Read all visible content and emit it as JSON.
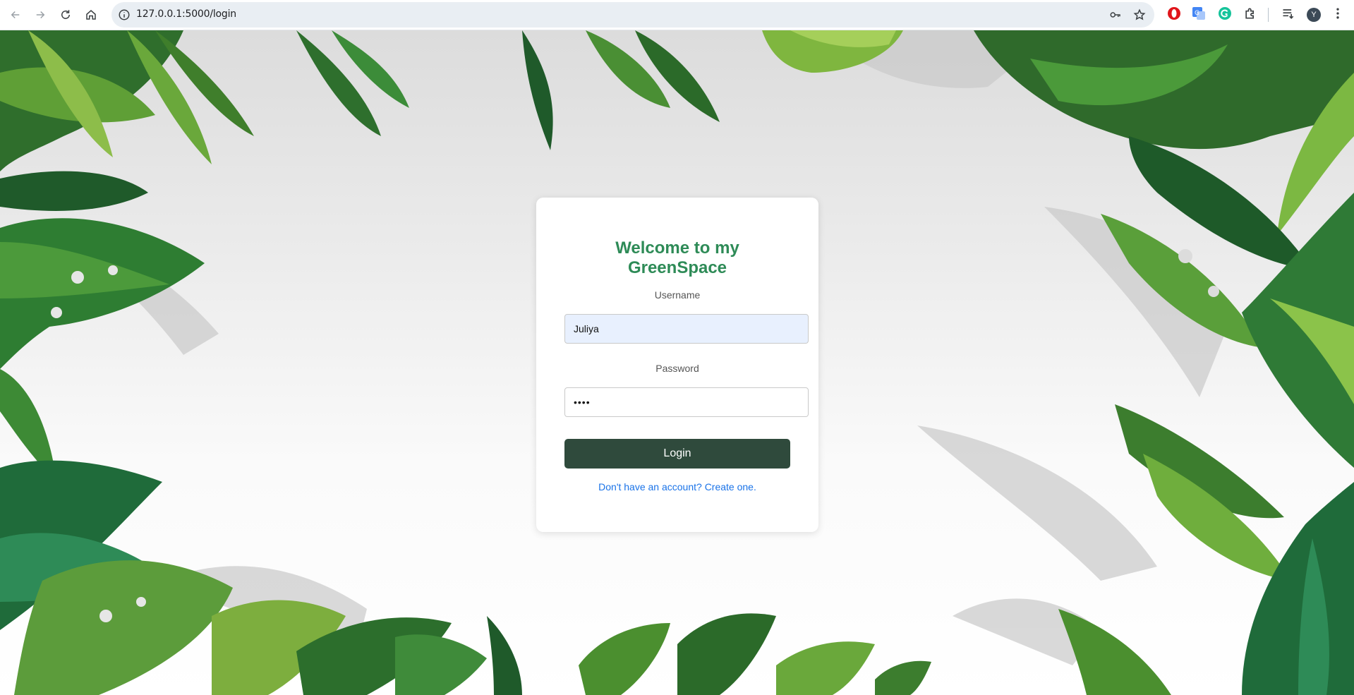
{
  "browser": {
    "url": "127.0.0.1:5000/login",
    "avatar_letter": "Y"
  },
  "login": {
    "title_line1": "Welcome to my",
    "title_line2": "GreenSpace",
    "username_label": "Username",
    "username_value": "Juliya",
    "password_label": "Password",
    "password_value": "••••",
    "login_button": "Login",
    "signup_link": "Don't have an account? Create one."
  },
  "colors": {
    "title": "#2e8b57",
    "button": "#2f4a3c",
    "link": "#1a73e8",
    "autofill": "#e8f0fe"
  }
}
